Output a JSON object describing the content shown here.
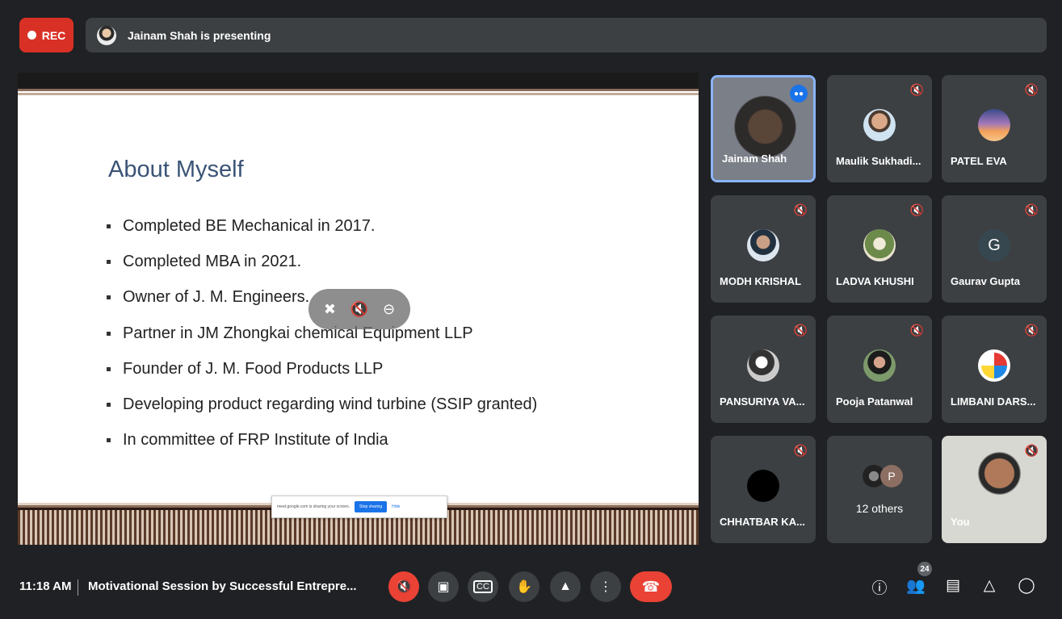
{
  "recording": {
    "label": "REC"
  },
  "presenter": {
    "text": "Jainam Shah is presenting"
  },
  "slide": {
    "title": "About Myself",
    "bullets": [
      "Completed BE Mechanical in 2017.",
      "Completed MBA in 2021.",
      "Owner of J. M. Engineers.",
      "Partner in JM Zhongkai chemical Equipment LLP",
      "Founder of J. M. Food Products LLP",
      "Developing product regarding wind turbine (SSIP granted)",
      "In committee of FRP Institute of India"
    ],
    "share_notice": {
      "text": "meet.google.com is sharing your screen.",
      "stop_label": "Stop sharing",
      "hide_label": "Hide"
    }
  },
  "participants": [
    {
      "name": "Jainam Shah",
      "type": "video",
      "speaking": true
    },
    {
      "name": "Maulik Sukhadi...",
      "type": "photo",
      "muted": true
    },
    {
      "name": "PATEL EVA",
      "type": "photo",
      "muted": true
    },
    {
      "name": "MODH KRISHAL",
      "type": "photo",
      "muted": true
    },
    {
      "name": "LADVA KHUSHI",
      "type": "photo",
      "muted": true
    },
    {
      "name": "Gaurav Gupta",
      "type": "initial",
      "initial": "G",
      "muted": true
    },
    {
      "name": "PANSURIYA VA...",
      "type": "photo",
      "muted": true
    },
    {
      "name": "Pooja Patanwal",
      "type": "photo",
      "muted": true
    },
    {
      "name": "LIMBANI DARS...",
      "type": "photo",
      "muted": true
    },
    {
      "name": "CHHATBAR KA...",
      "type": "photo",
      "muted": true
    },
    {
      "name": "12 others",
      "type": "others",
      "initial": "P"
    },
    {
      "name": "You",
      "type": "video",
      "muted": true
    }
  ],
  "bottom": {
    "time": "11:18 AM",
    "meeting_title": "Motivational Session by Successful Entrepre...",
    "people_count": "24"
  },
  "colors": {
    "background": "#202124",
    "tile": "#3c4043",
    "danger": "#ea4335",
    "accent": "#1a73e8"
  }
}
